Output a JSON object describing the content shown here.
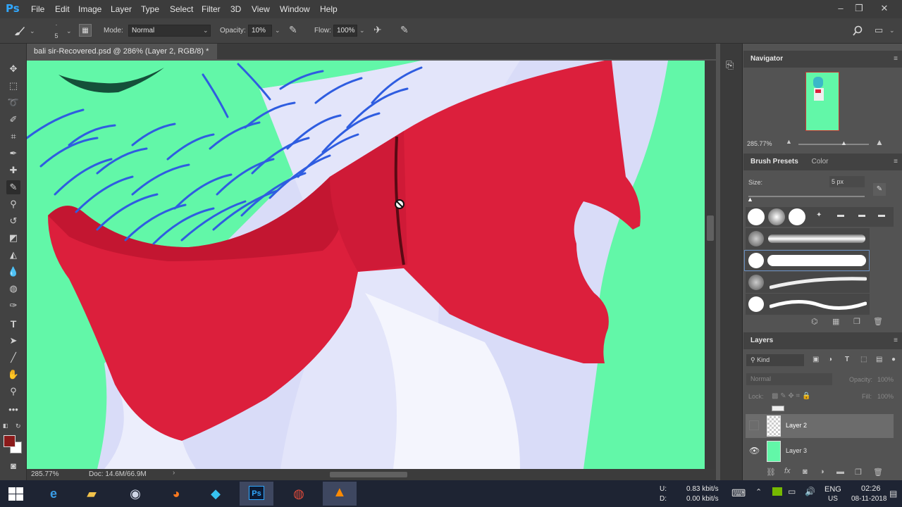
{
  "app": {
    "logo": "Ps"
  },
  "menu": [
    "File",
    "Edit",
    "Image",
    "Layer",
    "Type",
    "Select",
    "Filter",
    "3D",
    "View",
    "Window",
    "Help"
  ],
  "options_bar": {
    "brush_size": "5",
    "mode_label": "Mode:",
    "mode_value": "Normal",
    "opacity_label": "Opacity:",
    "opacity_value": "10%",
    "flow_label": "Flow:",
    "flow_value": "100%"
  },
  "document": {
    "tab_title": "bali sir-Recovered.psd @ 286% (Layer 2, RGB/8) *",
    "close_glyph": "×"
  },
  "status": {
    "zoom": "285.77%",
    "doc_size": "Doc: 14.6M/66.9M"
  },
  "navigator": {
    "title": "Navigator",
    "zoom": "285.77%"
  },
  "brush_presets": {
    "tab_active": "Brush Presets",
    "tab_other": "Color",
    "size_label": "Size:",
    "size_value": "5 px"
  },
  "layers": {
    "title": "Layers",
    "filter_kind": "Kind",
    "blend_mode": "Normal",
    "opacity_label": "Opacity:",
    "opacity_value": "100%",
    "lock_label": "Lock:",
    "fill_label": "Fill:",
    "fill_value": "100%",
    "items": [
      {
        "name": "Layer 2",
        "visible": false,
        "selected": true
      },
      {
        "name": "Layer 3",
        "visible": true,
        "selected": false
      }
    ]
  },
  "taskbar": {
    "network_up_label": "U:",
    "network_up": "0.83 kbit/s",
    "network_down_label": "D:",
    "network_down": "0.00 kbit/s",
    "lang": "ENG",
    "region": "US",
    "time": "02:26",
    "date": "08-11-2018"
  },
  "colors": {
    "canvas_bg": "#62f7a8",
    "bow_red": "#dc1f3c",
    "foreground_swatch": "#8b1a1a",
    "background_swatch": "#ffffff"
  }
}
